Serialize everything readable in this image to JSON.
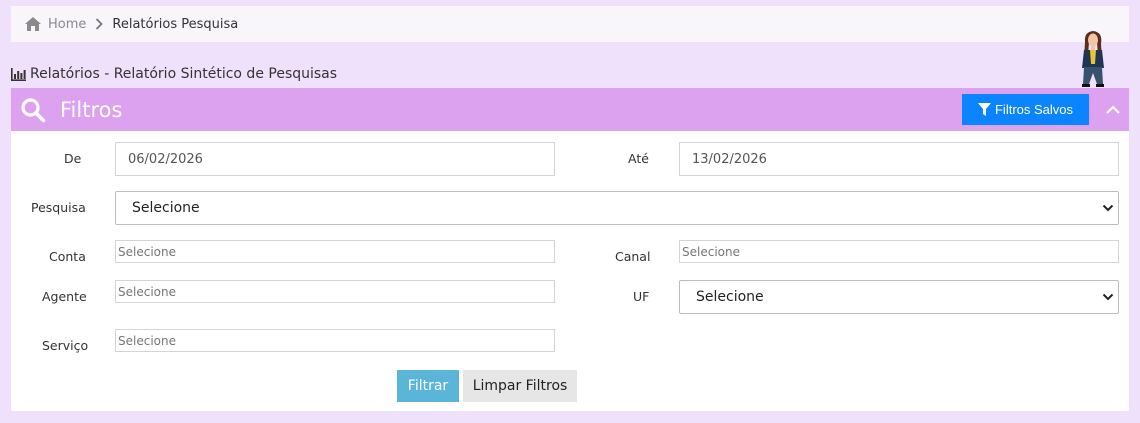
{
  "breadcrumb": {
    "home": "Home",
    "current": "Relatórios Pesquisa"
  },
  "page": {
    "title": "Relatórios - Relatório Sintético de Pesquisas"
  },
  "panel": {
    "title": "Filtros",
    "saved_filters_label": "Filtros Salvos",
    "accent": "#dca1ef",
    "button_color": "#0a84ff"
  },
  "filters": {
    "de_label": "De",
    "de_value": "06/02/2026",
    "ate_label": "Até",
    "ate_value": "13/02/2026",
    "pesquisa_label": "Pesquisa",
    "pesquisa_value": "Selecione",
    "conta_label": "Conta",
    "conta_placeholder": "Selecione",
    "canal_label": "Canal",
    "canal_placeholder": "Selecione",
    "agente_label": "Agente",
    "agente_placeholder": "Selecione",
    "uf_label": "UF",
    "uf_value": "Selecione",
    "servico_label": "Serviço",
    "servico_placeholder": "Selecione"
  },
  "actions": {
    "filter": "Filtrar",
    "clear": "Limpar Filtros"
  }
}
